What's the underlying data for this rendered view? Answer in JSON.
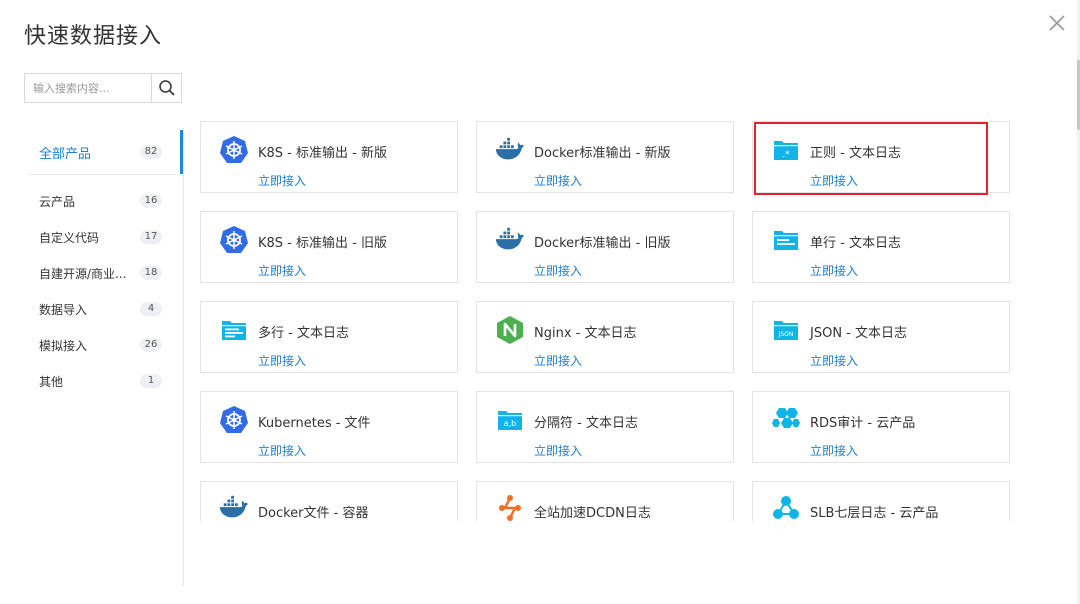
{
  "dialog": {
    "title": "快速数据接入",
    "search": {
      "placeholder": "输入搜索内容..."
    }
  },
  "sidebar": {
    "items": [
      {
        "label": "全部产品",
        "count": "82",
        "active": true
      },
      {
        "label": "云产品",
        "count": "16"
      },
      {
        "label": "自定义代码",
        "count": "17"
      },
      {
        "label": "自建开源/商业...",
        "count": "18"
      },
      {
        "label": "数据导入",
        "count": "4"
      },
      {
        "label": "模拟接入",
        "count": "26"
      },
      {
        "label": "其他",
        "count": "1"
      }
    ]
  },
  "cards": [
    {
      "name": "K8S - 标准输出 - 新版",
      "link": "立即接入",
      "icon": "kubernetes-icon"
    },
    {
      "name": "Docker标准输出 - 新版",
      "link": "立即接入",
      "icon": "docker-icon"
    },
    {
      "name": "正则 - 文本日志",
      "link": "立即接入",
      "icon": "regex-folder-icon"
    },
    {
      "name": "K8S - 标准输出 - 旧版",
      "link": "立即接入",
      "icon": "kubernetes-icon"
    },
    {
      "name": "Docker标准输出 - 旧版",
      "link": "立即接入",
      "icon": "docker-icon"
    },
    {
      "name": "单行 - 文本日志",
      "link": "立即接入",
      "icon": "single-line-folder-icon"
    },
    {
      "name": "多行 - 文本日志",
      "link": "立即接入",
      "icon": "multi-line-folder-icon"
    },
    {
      "name": "Nginx - 文本日志",
      "link": "立即接入",
      "icon": "nginx-icon"
    },
    {
      "name": "JSON - 文本日志",
      "link": "立即接入",
      "icon": "json-folder-icon"
    },
    {
      "name": "Kubernetes - 文件",
      "link": "立即接入",
      "icon": "kubernetes-icon"
    },
    {
      "name": "分隔符 - 文本日志",
      "link": "立即接入",
      "icon": "delimiter-folder-icon"
    },
    {
      "name": "RDS审计 - 云产品",
      "link": "立即接入",
      "icon": "rds-icon"
    },
    {
      "name": "Docker文件 - 容器",
      "link": "",
      "icon": "docker-icon"
    },
    {
      "name": "全站加速DCDN日志",
      "link": "",
      "icon": "dcdn-icon"
    },
    {
      "name": "SLB七层日志 - 云产品",
      "link": "",
      "icon": "slb-icon"
    }
  ],
  "colors": {
    "accent": "#1e7fd0",
    "highlight": "#e0222b",
    "k8s": "#326ce5",
    "docker": "#2a6fa8",
    "cyan": "#10b4e6",
    "nginx": "#4caf50",
    "dcdn": "#f07023"
  }
}
